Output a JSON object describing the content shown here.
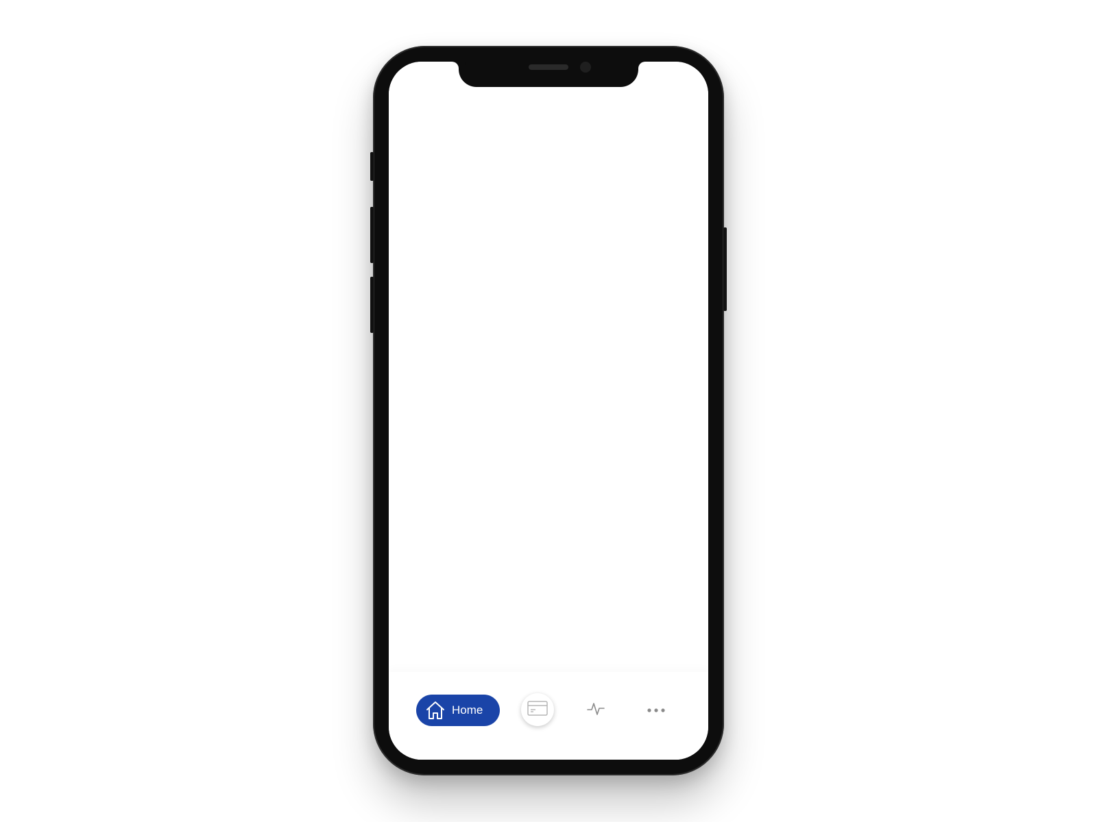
{
  "theme": {
    "accent": "#1a44a8",
    "icon_gray": "#9a9a9a",
    "background": "#ffffff"
  },
  "tabbar": {
    "items": [
      {
        "id": "home",
        "label": "Home",
        "icon": "home-icon",
        "active": true
      },
      {
        "id": "cards",
        "label": "",
        "icon": "credit-card-icon",
        "active": false
      },
      {
        "id": "activity",
        "label": "",
        "icon": "activity-icon",
        "active": false
      },
      {
        "id": "more",
        "label": "",
        "icon": "more-dots-icon",
        "active": false
      }
    ]
  }
}
